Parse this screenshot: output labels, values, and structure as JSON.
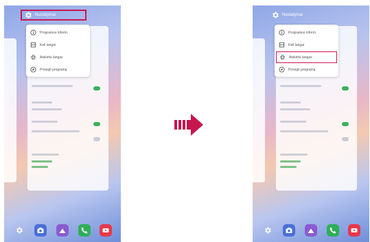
{
  "colors": {
    "highlight": "#c8174f",
    "arrow": "#c8174f"
  },
  "left": {
    "header": {
      "title": "Nustatymai"
    },
    "menu": [
      {
        "icon": "info-icon",
        "label": "Programos inform."
      },
      {
        "icon": "split-screen-icon",
        "label": "Keli langai"
      },
      {
        "icon": "minimize-window-icon",
        "label": "Atskirtis langas"
      },
      {
        "icon": "pin-icon",
        "label": "Prisegti programą"
      }
    ]
  },
  "right": {
    "header": {
      "title": "Nustatymai"
    },
    "menu": [
      {
        "icon": "info-icon",
        "label": "Programos inform."
      },
      {
        "icon": "split-screen-icon",
        "label": "Keli langai"
      },
      {
        "icon": "minimize-window-icon",
        "label": "Atskirtis langas"
      },
      {
        "icon": "pin-icon",
        "label": "Prisegti programą"
      }
    ]
  },
  "dock": [
    {
      "icon": "settings-icon"
    },
    {
      "icon": "camera-icon"
    },
    {
      "icon": "gallery-icon"
    },
    {
      "icon": "phone-icon"
    },
    {
      "icon": "youtube-icon"
    }
  ]
}
